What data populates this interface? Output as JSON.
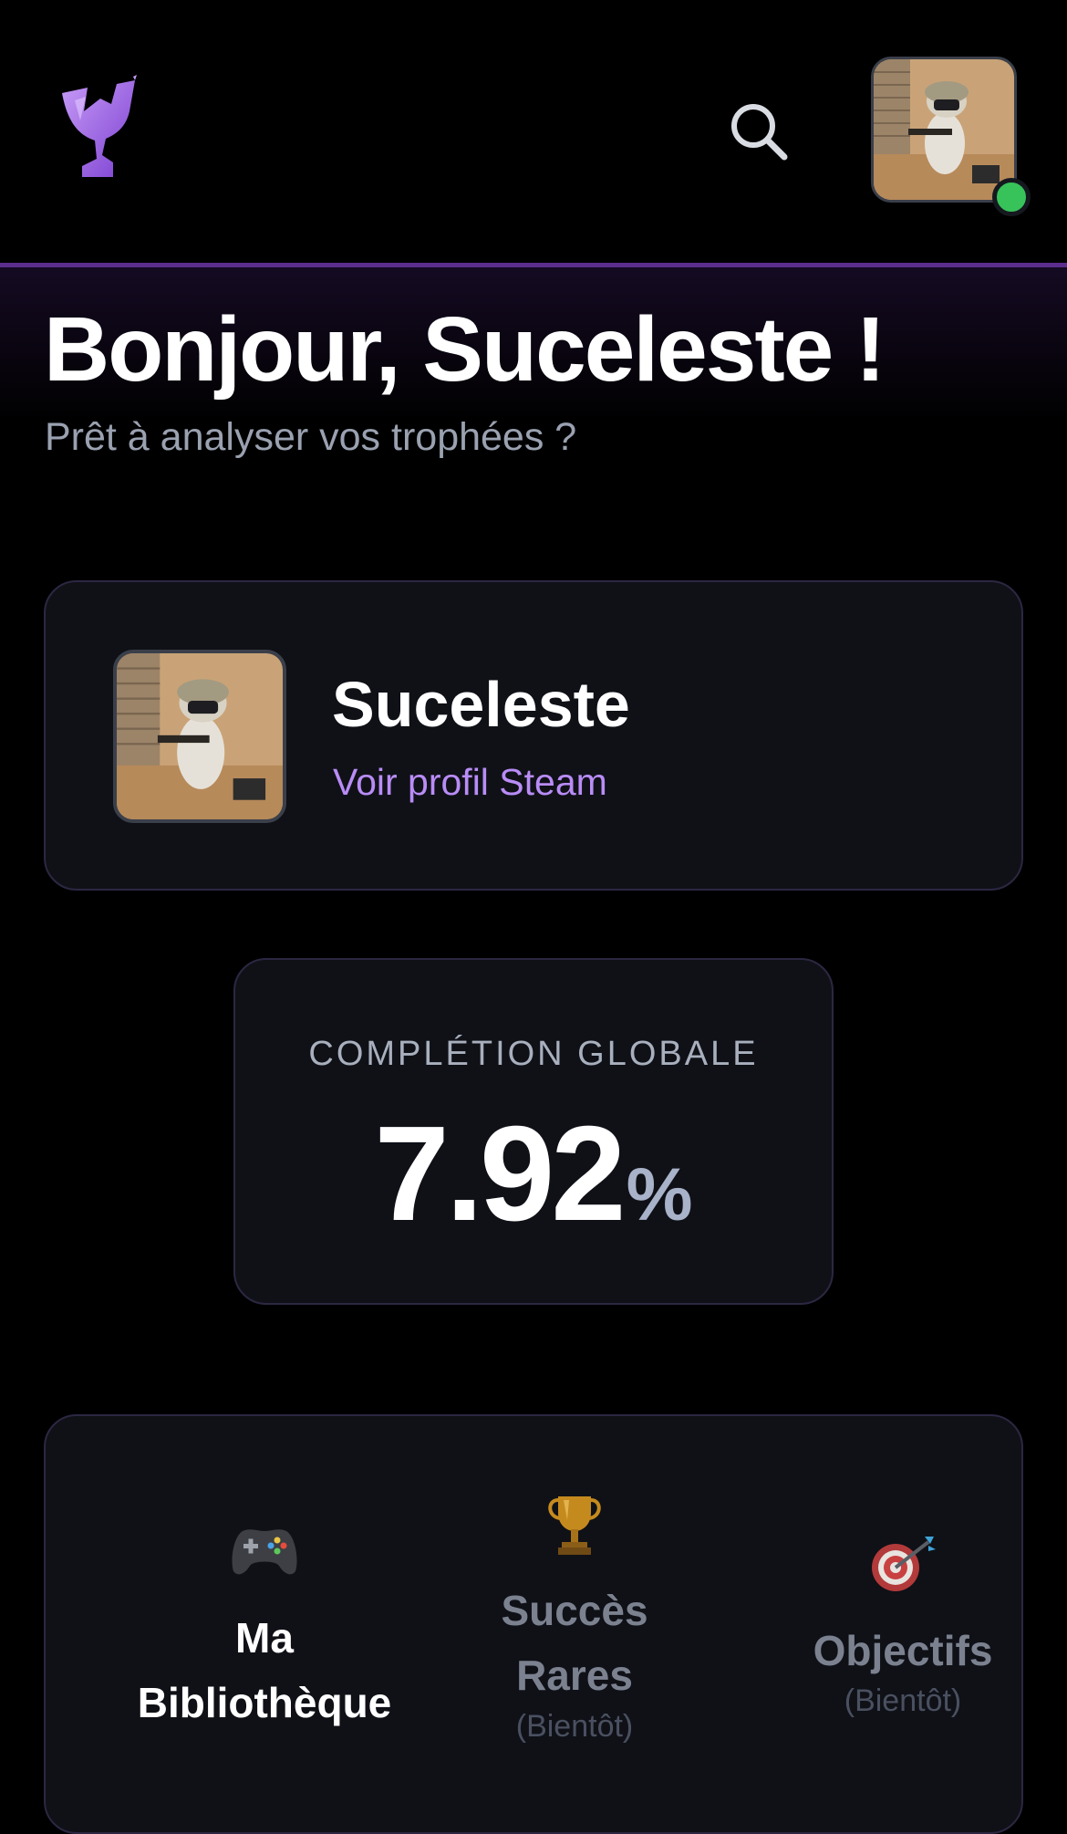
{
  "header": {
    "logo_icon": "trophy-logo-icon",
    "search_icon": "search-icon",
    "avatar_icon": "user-avatar",
    "online_status": "online"
  },
  "greeting": {
    "title": "Bonjour, Suceleste !",
    "subtitle": "Prêt à analyser vos trophées ?"
  },
  "profile": {
    "name": "Suceleste",
    "link": "Voir profil Steam"
  },
  "completion": {
    "label": "COMPLÉTION GLOBALE",
    "value": "7.92",
    "unit": "%"
  },
  "nav": {
    "items": [
      {
        "icon": "gamepad-icon",
        "label_line1": "Ma",
        "label_line2": "Bibliothèque",
        "sub": ""
      },
      {
        "icon": "trophy-icon",
        "label_line1": "Succès",
        "label_line2": "Rares",
        "sub": "(Bientôt)"
      },
      {
        "icon": "target-icon",
        "label_line1": "Objectifs",
        "label_line2": "",
        "sub": "(Bientôt)"
      }
    ]
  },
  "colors": {
    "background": "#000000",
    "card": "#0f1117",
    "card_border": "#2c2742",
    "accent": "#b98cf6",
    "header_line": "#5b2e8e",
    "online": "#37c35a"
  }
}
